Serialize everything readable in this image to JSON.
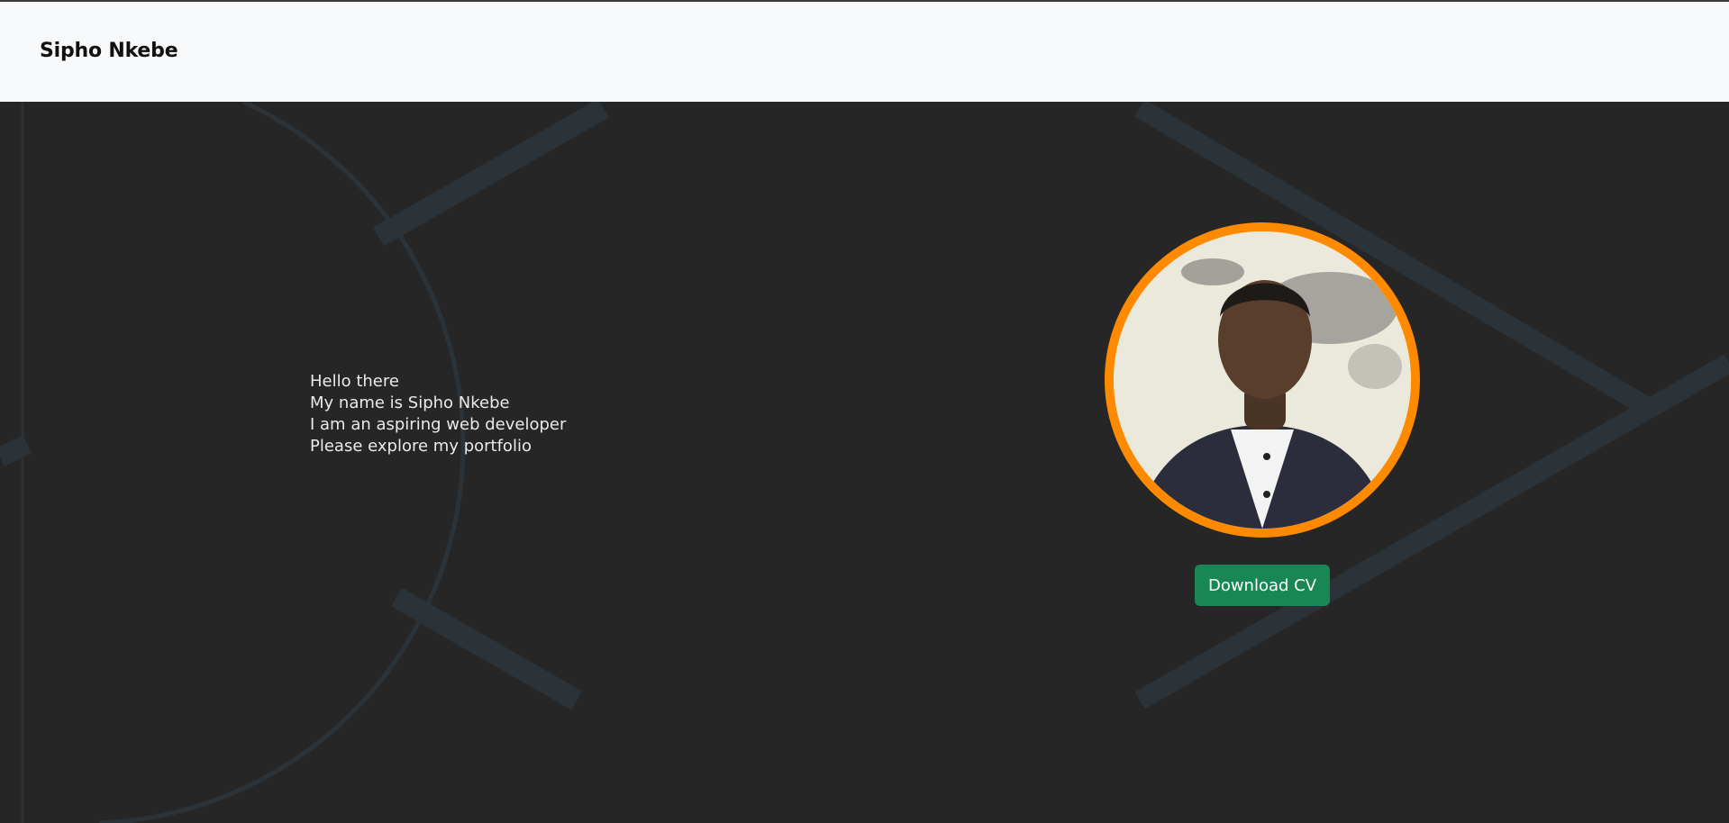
{
  "navbar": {
    "brand": "Sipho Nkebe"
  },
  "hero": {
    "lines": [
      "Hello there",
      "My name is Sipho Nkebe",
      "I am an aspiring web developer",
      "Please explore my portfolio"
    ],
    "cta_label": "Download CV"
  },
  "colors": {
    "background": "#262626",
    "navbar": "#f8f9fa",
    "avatar_ring": "#ff8a00",
    "cta": "#198754",
    "decor_lines": "#2b3338"
  },
  "icons": {
    "avatar": "profile-photo"
  }
}
